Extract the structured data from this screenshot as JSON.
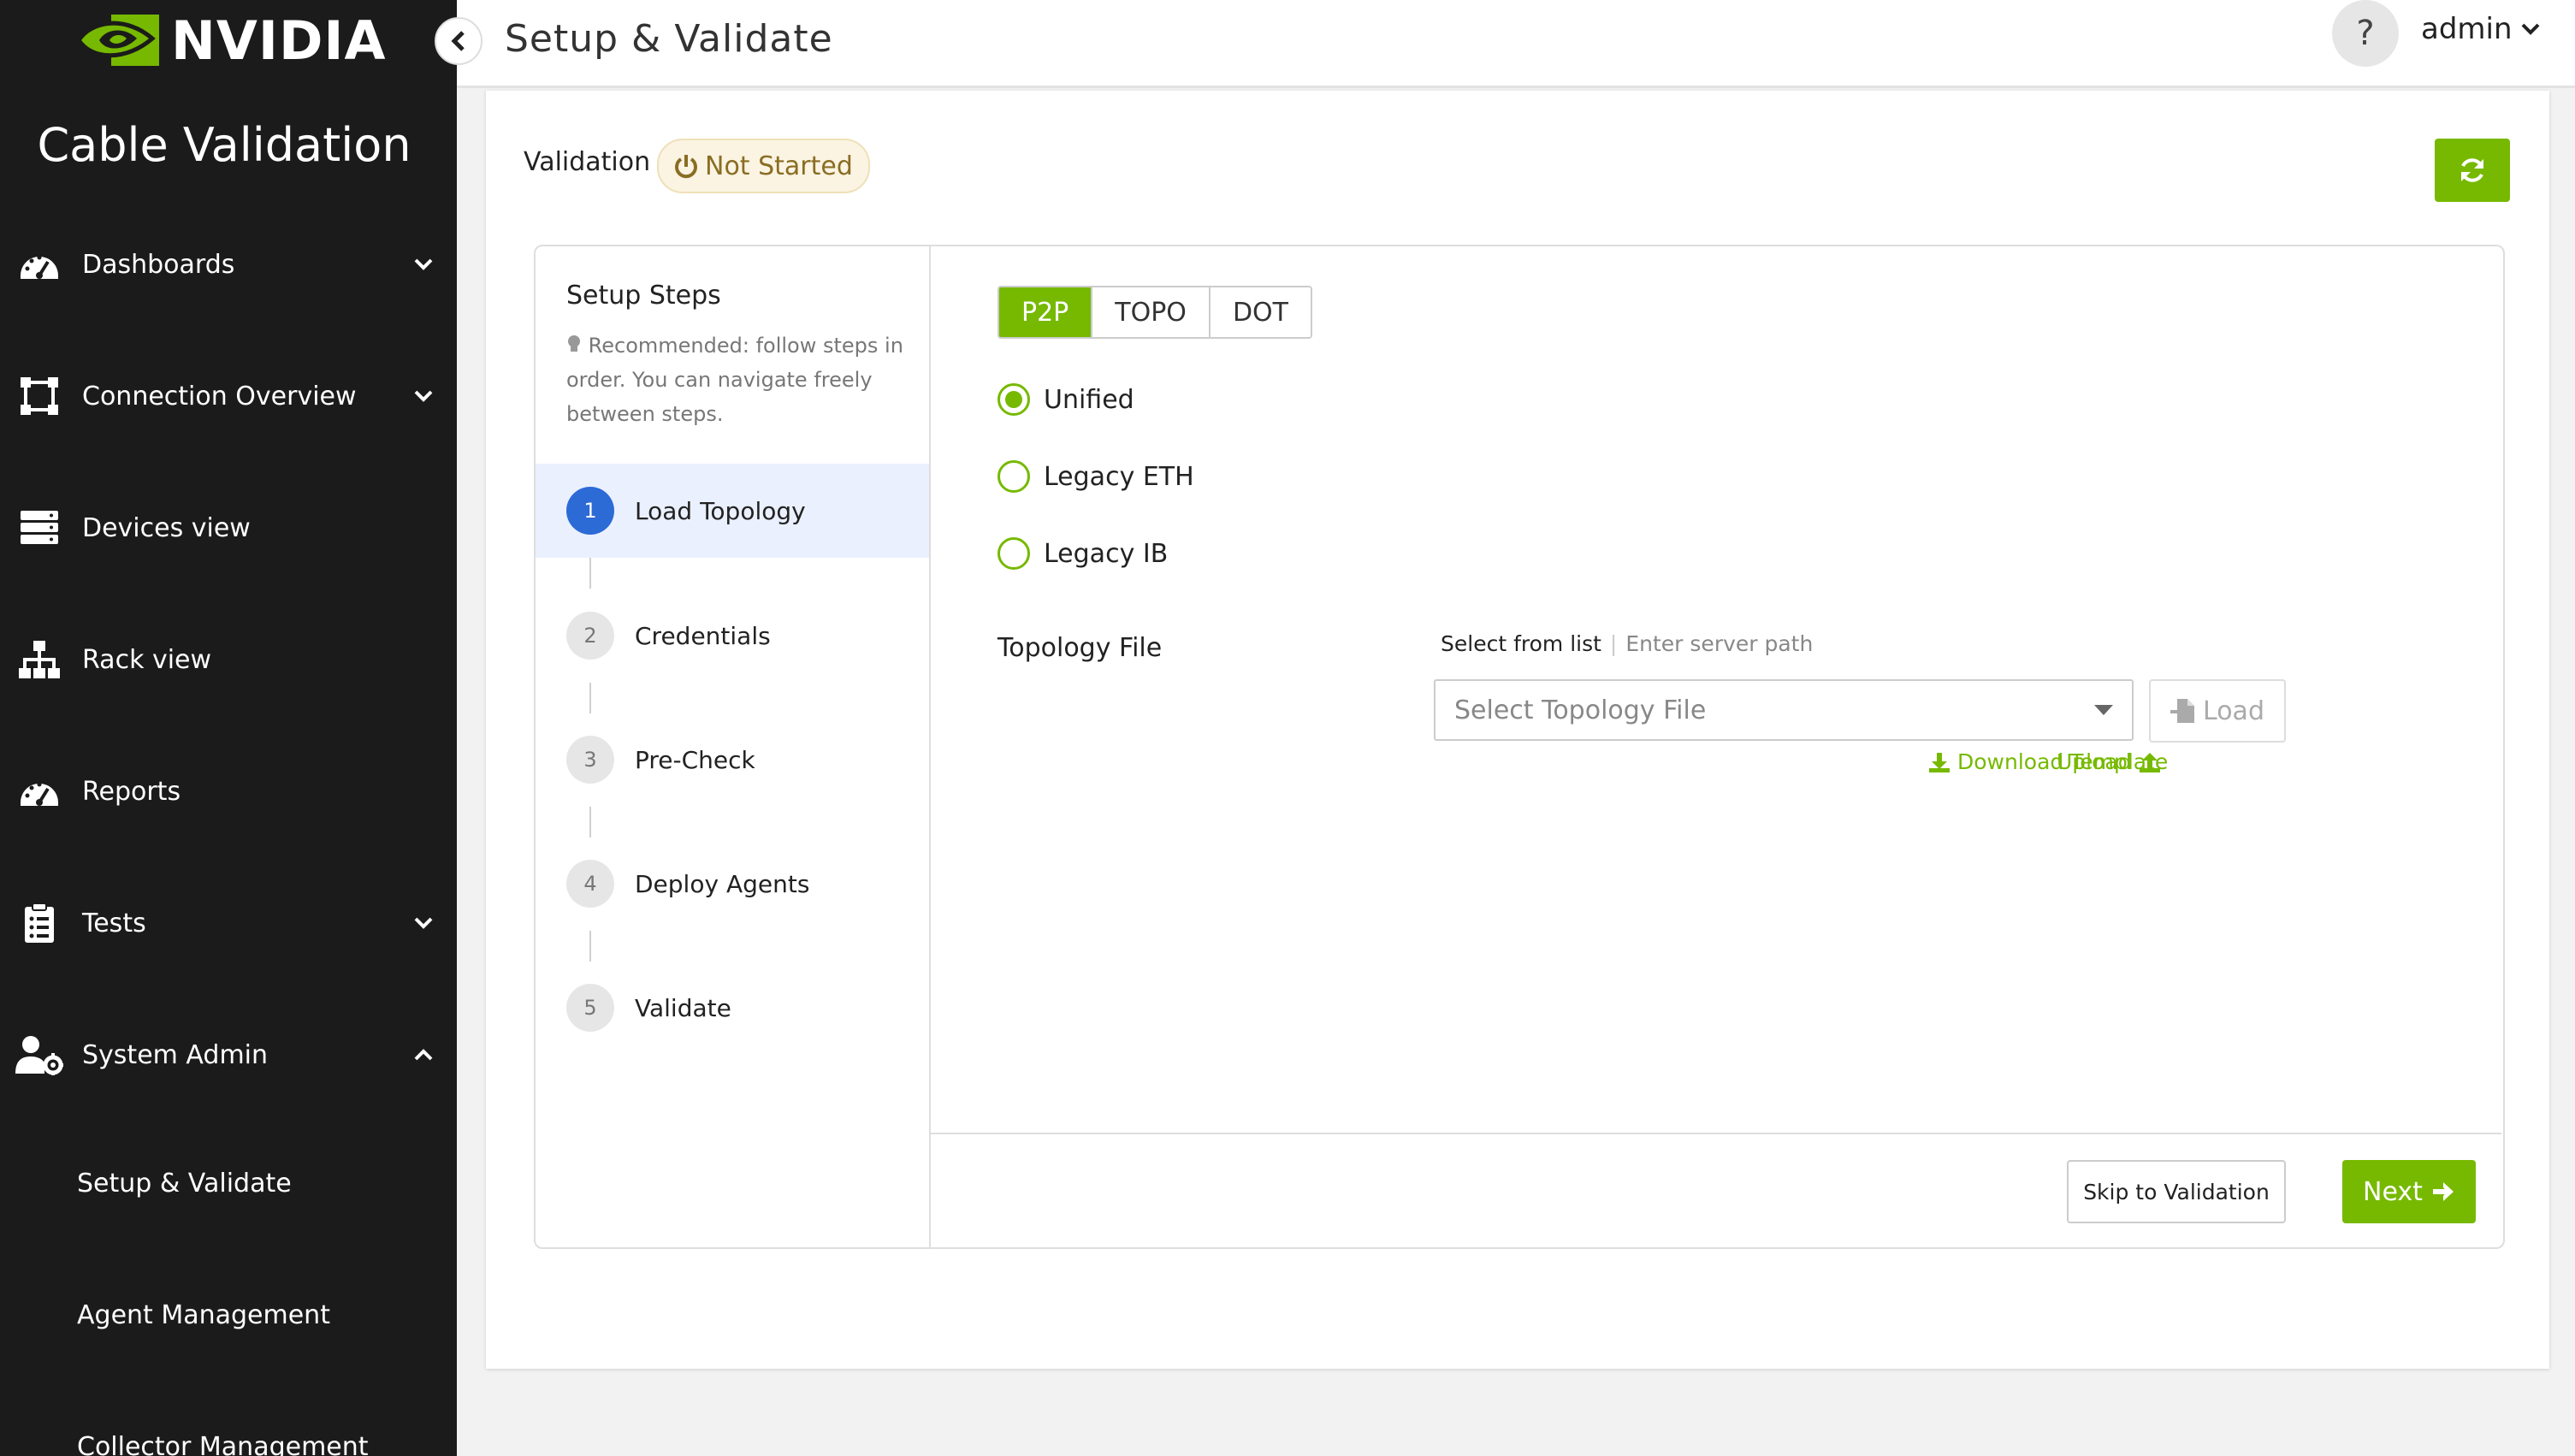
{
  "brand": {
    "logo_text": "NVIDIA",
    "accent": "#76b900"
  },
  "sidebar": {
    "app_title": "Cable Validation",
    "items": [
      {
        "label": "Dashboards",
        "icon": "dashboard-gauge-icon",
        "expandable": true,
        "expanded": false
      },
      {
        "label": "Connection Overview",
        "icon": "connection-nodes-icon",
        "expandable": true,
        "expanded": false
      },
      {
        "label": "Devices view",
        "icon": "server-stack-icon",
        "expandable": false
      },
      {
        "label": "Rack view",
        "icon": "network-tree-icon",
        "expandable": false
      },
      {
        "label": "Reports",
        "icon": "report-gauge-icon",
        "expandable": false
      },
      {
        "label": "Tests",
        "icon": "clipboard-icon",
        "expandable": true,
        "expanded": false
      },
      {
        "label": "System Admin",
        "icon": "user-gear-icon",
        "expandable": true,
        "expanded": true
      }
    ],
    "sub_items": [
      "Setup & Validate",
      "Agent Management",
      "Collector Management"
    ]
  },
  "header": {
    "title": "Setup & Validate",
    "help": "?",
    "user": "admin"
  },
  "validation": {
    "label": "Validation",
    "status": "Not Started"
  },
  "setup_steps": {
    "title": "Setup Steps",
    "hint": "Recommended: follow steps in order. You can navigate freely between steps.",
    "steps": [
      {
        "num": "1",
        "label": "Load Topology",
        "active": true
      },
      {
        "num": "2",
        "label": "Credentials",
        "active": false
      },
      {
        "num": "3",
        "label": "Pre-Check",
        "active": false
      },
      {
        "num": "4",
        "label": "Deploy Agents",
        "active": false
      },
      {
        "num": "5",
        "label": "Validate",
        "active": false
      }
    ]
  },
  "format_tabs": {
    "items": [
      "P2P",
      "TOPO",
      "DOT"
    ],
    "selected": "P2P"
  },
  "topology_type": {
    "options": [
      "Unified",
      "Legacy ETH",
      "Legacy IB"
    ],
    "selected": "Unified"
  },
  "topology_file": {
    "label": "Topology File",
    "source_list": "Select from list",
    "source_path": "Enter server path",
    "select_placeholder": "Select Topology File",
    "load_label": "Load",
    "download_template": "Download Template",
    "upload": "Upload"
  },
  "actions": {
    "skip": "Skip to Validation",
    "next": "Next"
  }
}
